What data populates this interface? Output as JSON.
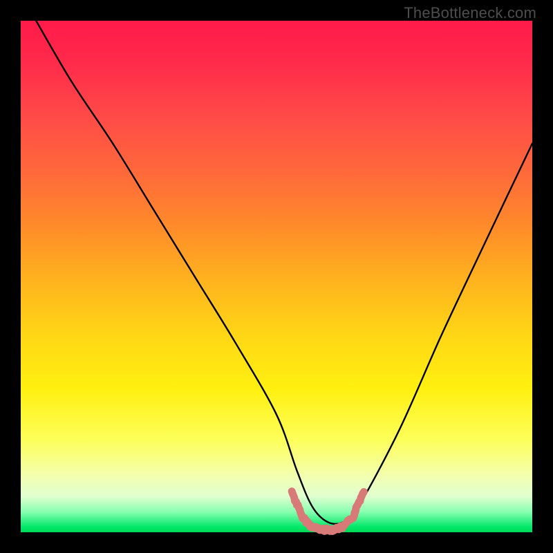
{
  "watermark": "TheBottleneck.com",
  "chart_data": {
    "type": "line",
    "title": "",
    "xlabel": "",
    "ylabel": "",
    "xlim": [
      0,
      100
    ],
    "ylim": [
      0,
      100
    ],
    "series": [
      {
        "name": "bottleneck-curve",
        "x": [
          3,
          10,
          18,
          26,
          34,
          42,
          50,
          54,
          57,
          60,
          63,
          66,
          74,
          82,
          90,
          100
        ],
        "values": [
          100,
          88,
          76,
          63,
          50,
          37,
          23,
          12,
          5,
          2,
          2,
          5,
          20,
          38,
          55,
          76
        ]
      },
      {
        "name": "optimal-band",
        "x": [
          53,
          55,
          57,
          59,
          61,
          63,
          65,
          67
        ],
        "values": [
          8,
          3,
          1,
          0.5,
          0.5,
          1,
          3,
          8
        ]
      }
    ],
    "gradient_stops": [
      {
        "pos": 0,
        "color": "#ff1a4a"
      },
      {
        "pos": 50,
        "color": "#ffd815"
      },
      {
        "pos": 88,
        "color": "#f3ffb0"
      },
      {
        "pos": 100,
        "color": "#00d858"
      }
    ],
    "optimal_color": "#d87a78"
  }
}
